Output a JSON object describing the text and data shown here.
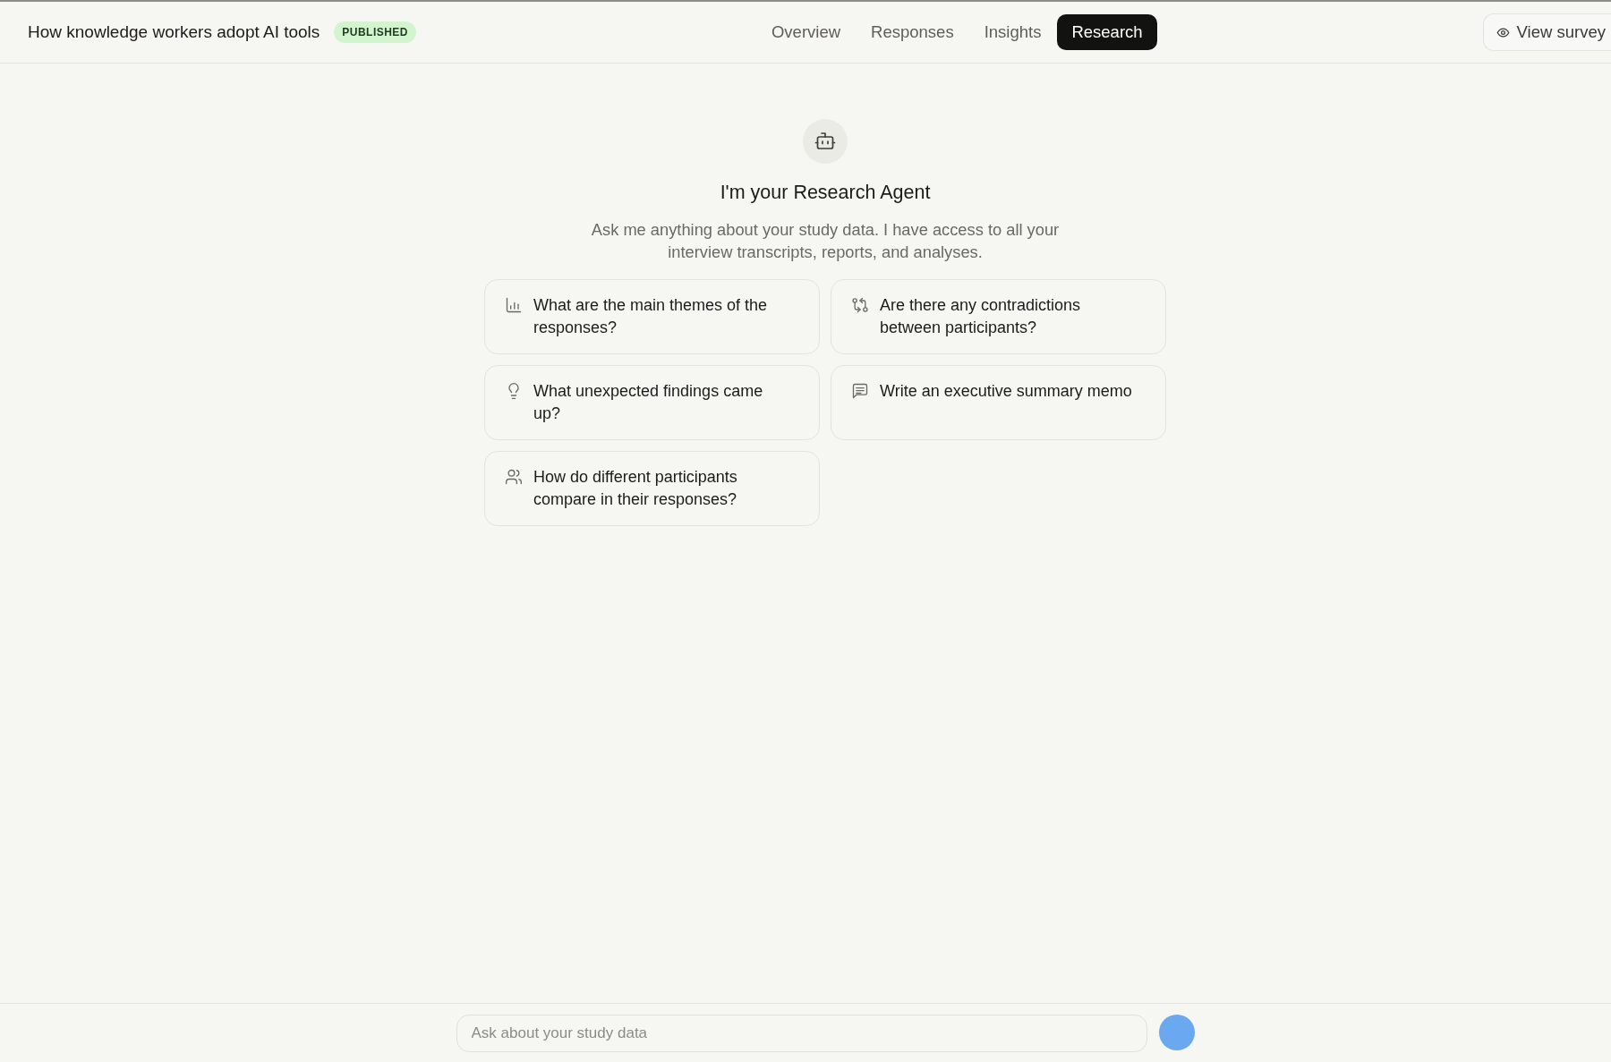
{
  "header": {
    "title": "How knowledge workers adopt AI tools",
    "status_badge": "PUBLISHED",
    "tabs": [
      {
        "label": "Overview",
        "selected": false
      },
      {
        "label": "Responses",
        "selected": false
      },
      {
        "label": "Insights",
        "selected": false
      },
      {
        "label": "Research",
        "selected": true
      }
    ],
    "view_survey_button": "View survey"
  },
  "agent": {
    "heading": "I'm your Research Agent",
    "description": "Ask me anything about your study data. I have access to all your interview transcripts, reports, and analyses."
  },
  "suggestions": [
    {
      "kind": "chart",
      "text": "What are the main themes of the responses?"
    },
    {
      "kind": "compare",
      "text": "Are there any contradictions between participants?"
    },
    {
      "kind": "bulb",
      "text": "What unexpected findings came up?"
    },
    {
      "kind": "note",
      "text": "Write an executive summary memo"
    },
    {
      "kind": "people",
      "text": "How do different participants compare in their responses?"
    }
  ],
  "composer": {
    "placeholder": "Ask about your study data"
  }
}
